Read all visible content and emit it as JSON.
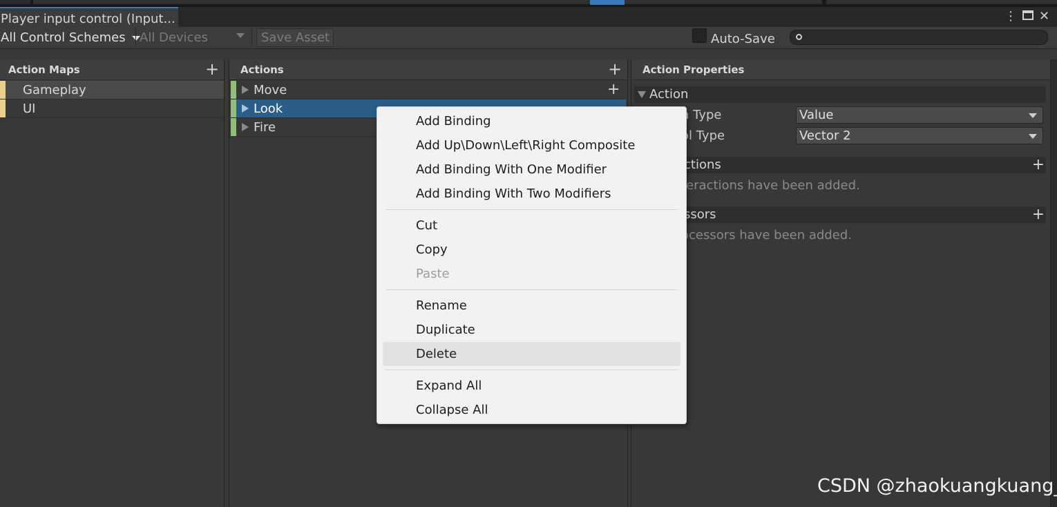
{
  "window": {
    "tab_title": "Player input control (Input...",
    "menu_icon": "⋮",
    "maximize_icon": "maximize-icon",
    "close_icon": "✕"
  },
  "toolbar": {
    "control_schemes": "All Control Schemes",
    "devices": "All Devices",
    "save_asset": "Save Asset",
    "auto_save": "Auto-Save",
    "search_icon": "🔍"
  },
  "action_maps": {
    "title": "Action Maps",
    "items": [
      {
        "label": "Gameplay",
        "selected": true
      },
      {
        "label": "UI",
        "selected": false
      }
    ],
    "accent": "#e9d08a"
  },
  "actions": {
    "title": "Actions",
    "items": [
      {
        "label": "Move"
      },
      {
        "label": "Look",
        "selected": true
      },
      {
        "label": "Fire"
      }
    ],
    "accent": "#8fbf7a",
    "selected_color": "#2c5d87"
  },
  "properties": {
    "title": "Action Properties",
    "section_action": "Action",
    "action_type_label": "n Type",
    "action_type_value": "Value",
    "control_type_label": "ol Type",
    "control_type_value": "Vector 2",
    "interactions_label": "ctions",
    "interactions_empty": "teractions have been added.",
    "processors_label": "ssors",
    "processors_empty": "ocessors have been added."
  },
  "context_menu": {
    "group1": [
      "Add Binding",
      "Add Up\\Down\\Left\\Right Composite",
      "Add Binding With One Modifier",
      "Add Binding With Two Modifiers"
    ],
    "group2": [
      "Cut",
      "Copy",
      "Paste"
    ],
    "group3": [
      "Rename",
      "Duplicate",
      "Delete"
    ],
    "group4": [
      "Expand All",
      "Collapse All"
    ]
  },
  "watermark": "CSDN @zhaokuangkuang_"
}
